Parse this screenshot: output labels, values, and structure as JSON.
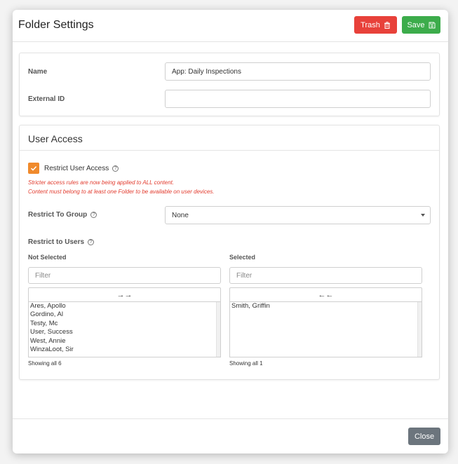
{
  "header": {
    "title": "Folder Settings",
    "trash_label": "Trash",
    "save_label": "Save"
  },
  "details": {
    "name_label": "Name",
    "name_value": "App: Daily Inspections",
    "external_id_label": "External ID",
    "external_id_value": ""
  },
  "user_access": {
    "title": "User Access",
    "restrict_label": "Restrict User Access",
    "restrict_checked": true,
    "warning_line1": "Stricter access rules are now being applied to ALL content.",
    "warning_line2": "Content must belong to at least one Folder to be available on user devices.",
    "group_label": "Restrict To Group",
    "group_value": "None",
    "users_label": "Restrict to Users",
    "not_selected": {
      "heading": "Not Selected",
      "filter_placeholder": "Filter",
      "move_label": "→→",
      "items": [
        "Ares, Apollo",
        "Gordino, Al",
        "Testy, Mc",
        "User, Success",
        "West, Annie",
        "WinzaLoot, Sir"
      ],
      "showing": "Showing all 6"
    },
    "selected": {
      "heading": "Selected",
      "filter_placeholder": "Filter",
      "move_label": "←←",
      "items": [
        "Smith, Griffin"
      ],
      "showing": "Showing all 1"
    }
  },
  "footer": {
    "close_label": "Close"
  },
  "colors": {
    "trash": "#e8413a",
    "save": "#3cac4b",
    "checkbox": "#f08a2c",
    "warning": "#e23b2e",
    "close": "#6c757d"
  },
  "icons": {
    "trash": "trash-icon",
    "save": "floppy-disk-icon",
    "help": "question-circle-icon"
  }
}
